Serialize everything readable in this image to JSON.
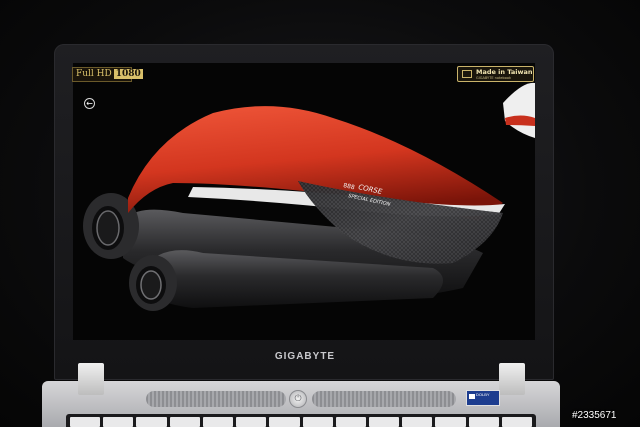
{
  "screen": {
    "badge_fullhd": {
      "label": "Full HD",
      "resolution": "1080"
    },
    "badge_made_in": {
      "label": "Made in Taiwan",
      "sub": "GIGABYTE notebook"
    },
    "back_arrow_icon": "back-arrow-icon",
    "photo_text": {
      "model": "888",
      "brand": "CORSE",
      "edition": "SPECIAL EDITION"
    }
  },
  "bezel": {
    "logo": "GIGABYTE"
  },
  "base": {
    "sticker": "DOLBY"
  },
  "watermark": "#2335671",
  "colors": {
    "fairing_red": "#d63a22",
    "carbon": "#3a3a3c",
    "laptop_silver": "#c8c9cc",
    "background": "#0a0a0b"
  }
}
